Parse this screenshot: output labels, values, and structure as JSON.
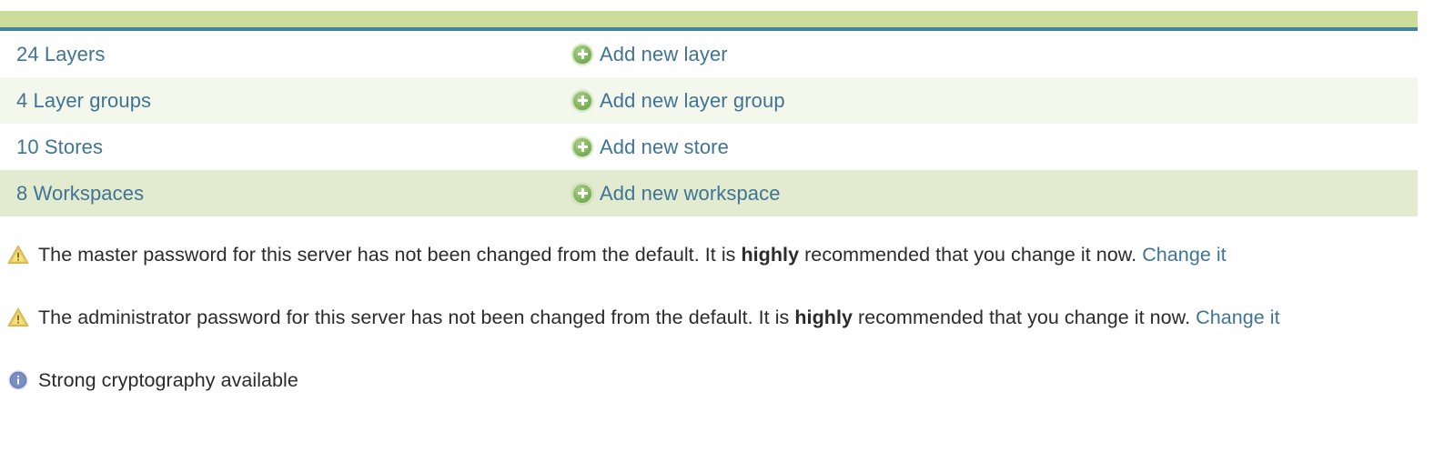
{
  "catalog": {
    "rows": [
      {
        "count_label": "24 Layers",
        "action_label": "Add new layer",
        "icon": "add-circle-icon",
        "row_style": "bg-white"
      },
      {
        "count_label": "4 Layer groups",
        "action_label": "Add new layer group",
        "icon": "add-circle-icon",
        "row_style": "bg-pale"
      },
      {
        "count_label": "10 Stores",
        "action_label": "Add new store",
        "icon": "add-circle-icon",
        "row_style": "bg-white"
      },
      {
        "count_label": "8 Workspaces",
        "action_label": "Add new workspace",
        "icon": "add-circle-icon",
        "row_style": "bg-green"
      }
    ]
  },
  "messages": [
    {
      "icon": "warning-icon",
      "text_before": "The master password for this server has not been changed from the default. It is ",
      "emphasis": "highly",
      "text_after": " recommended that you change it now. ",
      "link_label": "Change it"
    },
    {
      "icon": "warning-icon",
      "text_before": "The administrator password for this server has not been changed from the default. It is ",
      "emphasis": "highly",
      "text_after": " recommended that you change it now. ",
      "link_label": "Change it"
    },
    {
      "icon": "info-icon",
      "text_before": "Strong cryptography available",
      "emphasis": "",
      "text_after": "",
      "link_label": ""
    }
  ],
  "colors": {
    "header_band": "#cbdc9b",
    "header_rule": "#44819d",
    "link": "#3f7495",
    "row_alt": "#f4f8ec",
    "row_highlight": "#e2ead0",
    "text": "#2b2b2b",
    "add_icon_green": "#84b761",
    "warning_yellow": "#e8c55a",
    "info_blue": "#7b8fc4"
  }
}
